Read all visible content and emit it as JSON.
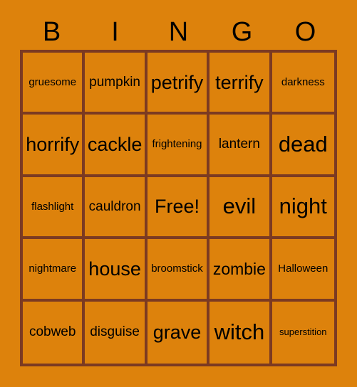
{
  "card": {
    "title_letters": [
      "B",
      "I",
      "N",
      "G",
      "O"
    ],
    "colors": {
      "background": "#DD820C",
      "grid_border": "#7B3A22",
      "text": "#000000"
    },
    "rows": [
      [
        {
          "text": "gruesome",
          "size": "fs-sm"
        },
        {
          "text": "pumpkin",
          "size": "fs-md"
        },
        {
          "text": "petrify",
          "size": "fs-xl"
        },
        {
          "text": "terrify",
          "size": "fs-xl"
        },
        {
          "text": "darkness",
          "size": "fs-sm"
        }
      ],
      [
        {
          "text": "horrify",
          "size": "fs-xl"
        },
        {
          "text": "cackle",
          "size": "fs-xl"
        },
        {
          "text": "frightening",
          "size": "fs-sm"
        },
        {
          "text": "lantern",
          "size": "fs-md"
        },
        {
          "text": "dead",
          "size": "fs-xxl"
        }
      ],
      [
        {
          "text": "flashlight",
          "size": "fs-sm"
        },
        {
          "text": "cauldron",
          "size": "fs-md"
        },
        {
          "text": "Free!",
          "size": "fs-xl"
        },
        {
          "text": "evil",
          "size": "fs-xxl"
        },
        {
          "text": "night",
          "size": "fs-xxl"
        }
      ],
      [
        {
          "text": "nightmare",
          "size": "fs-sm"
        },
        {
          "text": "house",
          "size": "fs-xl"
        },
        {
          "text": "broomstick",
          "size": "fs-sm"
        },
        {
          "text": "zombie",
          "size": "fs-lg"
        },
        {
          "text": "Halloween",
          "size": "fs-sm"
        }
      ],
      [
        {
          "text": "cobweb",
          "size": "fs-md"
        },
        {
          "text": "disguise",
          "size": "fs-md"
        },
        {
          "text": "grave",
          "size": "fs-xl"
        },
        {
          "text": "witch",
          "size": "fs-xxl"
        },
        {
          "text": "superstition",
          "size": "fs-xs"
        }
      ]
    ]
  }
}
